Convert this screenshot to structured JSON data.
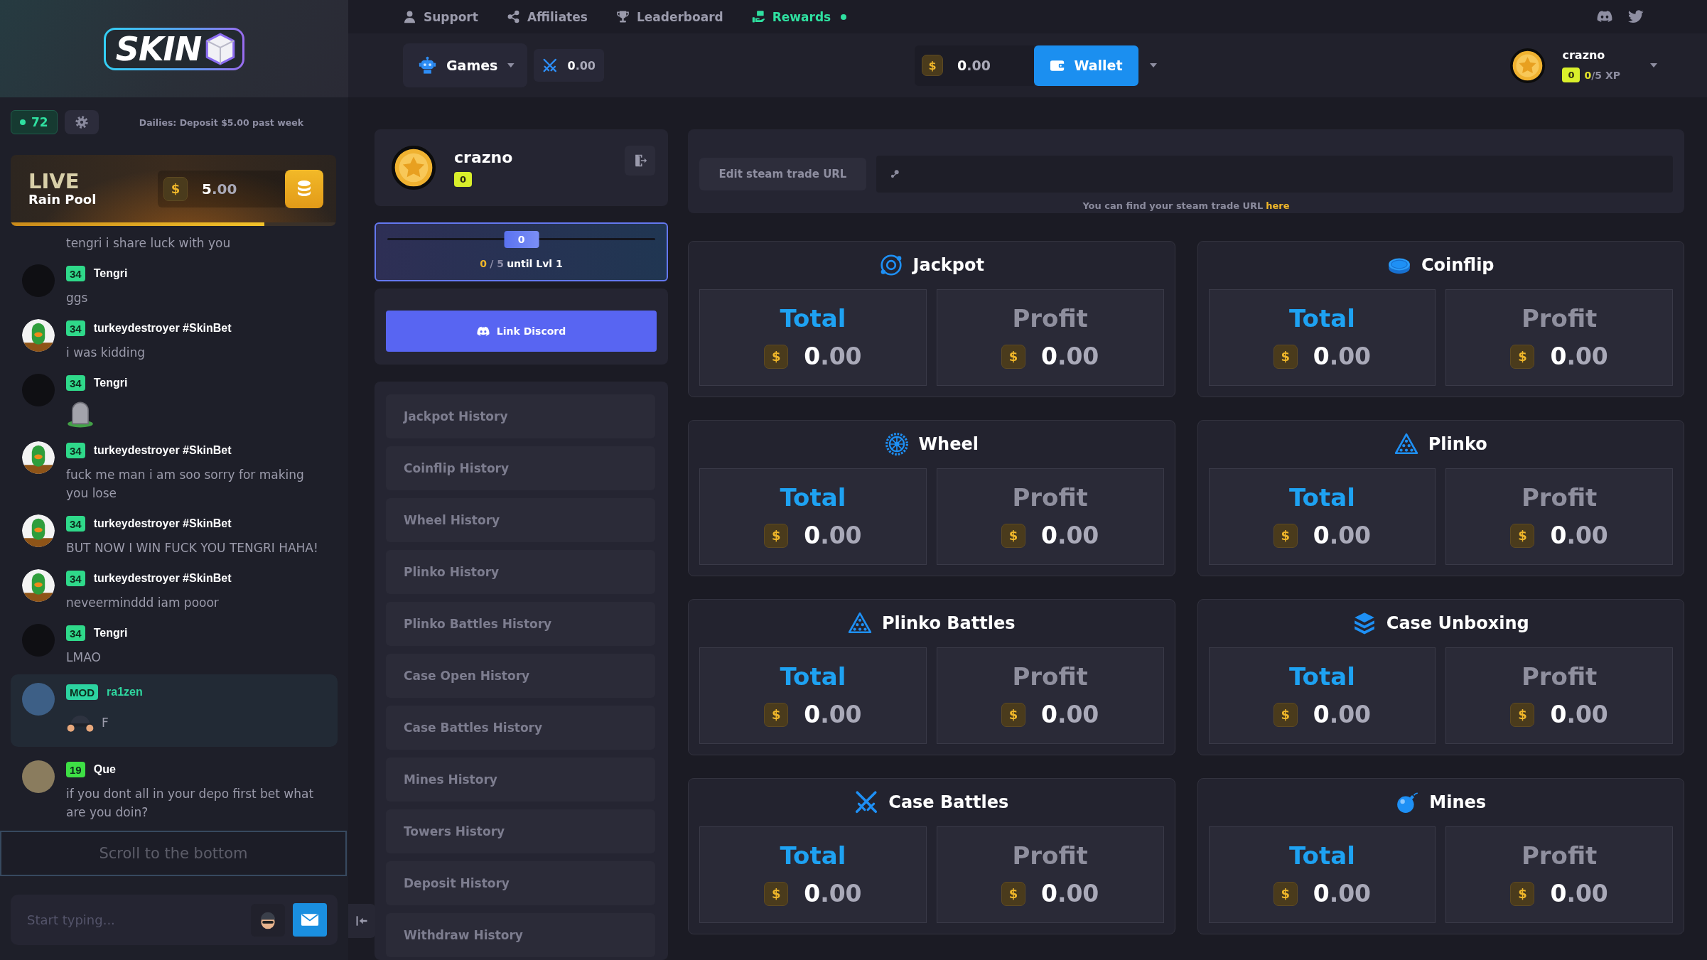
{
  "sidebar": {
    "logo": {
      "text": "SKIN"
    },
    "online_count": "72",
    "dailies": "Dailies: Deposit $5.00 past week",
    "rain_pool": {
      "live": "LIVE",
      "title": "Rain Pool",
      "currency": "$",
      "amount": "5.00",
      "level": 0.78
    },
    "chat": {
      "messages": [
        {
          "highlighted": false,
          "text": "tengri i share luck with you"
        },
        {
          "user": "Tengri",
          "badge": {
            "text": "34",
            "color": "#2fd98a"
          },
          "avatar": {
            "kind": "photo",
            "color": "#0f0f13"
          },
          "highlighted": false,
          "text": "ggs"
        },
        {
          "user": "turkeydestroyer #SkinBet",
          "badge": {
            "text": "34",
            "color": "#2fd98a"
          },
          "avatar": {
            "kind": "duck"
          },
          "highlighted": false,
          "text": "i was kidding"
        },
        {
          "user": "Tengri",
          "badge": {
            "text": "34",
            "color": "#2fd98a"
          },
          "avatar": {
            "kind": "photo",
            "color": "#0f0f13"
          },
          "highlighted": false,
          "emote": {
            "kind": "grave"
          }
        },
        {
          "user": "turkeydestroyer #SkinBet",
          "badge": {
            "text": "34",
            "color": "#2fd98a"
          },
          "avatar": {
            "kind": "duck"
          },
          "highlighted": false,
          "text": "fuck me man i am soo sorry for making you lose"
        },
        {
          "user": "turkeydestroyer #SkinBet",
          "badge": {
            "text": "34",
            "color": "#2fd98a"
          },
          "avatar": {
            "kind": "duck"
          },
          "highlighted": false,
          "text": "BUT NOW I WIN FUCK YOU TENGRI HAHA!"
        },
        {
          "user": "turkeydestroyer #SkinBet",
          "badge": {
            "text": "34",
            "color": "#2fd98a"
          },
          "avatar": {
            "kind": "duck"
          },
          "highlighted": false,
          "text": "neveerminddd iam pooor"
        },
        {
          "user": "Tengri",
          "badge": {
            "text": "34",
            "color": "#2fd98a"
          },
          "avatar": {
            "kind": "photo",
            "color": "#0f0f13"
          },
          "highlighted": false,
          "text": "LMAO"
        },
        {
          "user": "ra1zen",
          "badge": {
            "text": "MOD",
            "color": "#2cd3a0"
          },
          "avatar": {
            "kind": "photo",
            "color": "#3d5f86"
          },
          "highlighted": true,
          "emote": {
            "kind": "cap"
          },
          "text": "F"
        },
        {
          "user": "Que",
          "badge": {
            "text": "19",
            "color": "#3ee045"
          },
          "avatar": {
            "kind": "photo",
            "color": "#8a7c5e"
          },
          "highlighted": false,
          "text": "if you dont all in your depo first bet what are you doin?"
        }
      ],
      "scroll_hint": "Scroll to the bottom",
      "input": {
        "placeholder": "Start typing..."
      }
    }
  },
  "nav": {
    "links": [
      {
        "kind": "support",
        "label": "Support",
        "selected": false,
        "dot": false
      },
      {
        "kind": "affiliates",
        "label": "Affiliates",
        "selected": false,
        "dot": false
      },
      {
        "kind": "leaderboard",
        "label": "Leaderboard",
        "selected": false,
        "dot": false
      },
      {
        "kind": "rewards",
        "label": "Rewards",
        "selected": true,
        "dot": true
      }
    ],
    "games": "Games",
    "battles_balance": "0.00",
    "balance": {
      "currency": "$",
      "value": "0.00"
    },
    "wallet": "Wallet",
    "user": {
      "name": "crazno",
      "rank": "0",
      "xp_current": "0",
      "xp_rest": "/5 XP"
    }
  },
  "profile": {
    "name": "crazno",
    "rank": "0",
    "xp": {
      "marker": "0",
      "current": "0",
      "total": "/ 5",
      "label": "until Lvl 1"
    },
    "discord_button": "Link Discord",
    "history": [
      "Jackpot History",
      "Coinflip History",
      "Wheel History",
      "Plinko History",
      "Plinko Battles History",
      "Case Open History",
      "Case Battles History",
      "Mines History",
      "Towers History",
      "Deposit History",
      "Withdraw History"
    ]
  },
  "trade_url": {
    "button": "Edit steam trade URL",
    "hint": "You can find your steam trade URL",
    "link": "here"
  },
  "games": [
    {
      "kind": "jackpot",
      "title": "Jackpot",
      "stats": [
        {
          "kind": "total",
          "label": "Total",
          "currency": "$",
          "value": "0.00"
        },
        {
          "kind": "profit",
          "label": "Profit",
          "currency": "$",
          "value": "0.00"
        }
      ]
    },
    {
      "kind": "coinflip",
      "title": "Coinflip",
      "stats": [
        {
          "kind": "total",
          "label": "Total",
          "currency": "$",
          "value": "0.00"
        },
        {
          "kind": "profit",
          "label": "Profit",
          "currency": "$",
          "value": "0.00"
        }
      ]
    },
    {
      "kind": "wheel",
      "title": "Wheel",
      "stats": [
        {
          "kind": "total",
          "label": "Total",
          "currency": "$",
          "value": "0.00"
        },
        {
          "kind": "profit",
          "label": "Profit",
          "currency": "$",
          "value": "0.00"
        }
      ]
    },
    {
      "kind": "plinko",
      "title": "Plinko",
      "stats": [
        {
          "kind": "total",
          "label": "Total",
          "currency": "$",
          "value": "0.00"
        },
        {
          "kind": "profit",
          "label": "Profit",
          "currency": "$",
          "value": "0.00"
        }
      ]
    },
    {
      "kind": "plinko",
      "title": "Plinko Battles",
      "stats": [
        {
          "kind": "total",
          "label": "Total",
          "currency": "$",
          "value": "0.00"
        },
        {
          "kind": "profit",
          "label": "Profit",
          "currency": "$",
          "value": "0.00"
        }
      ]
    },
    {
      "kind": "case",
      "title": "Case Unboxing",
      "stats": [
        {
          "kind": "total",
          "label": "Total",
          "currency": "$",
          "value": "0.00"
        },
        {
          "kind": "profit",
          "label": "Profit",
          "currency": "$",
          "value": "0.00"
        }
      ]
    },
    {
      "kind": "battles",
      "title": "Case Battles",
      "stats": [
        {
          "kind": "total",
          "label": "Total",
          "currency": "$",
          "value": "0.00"
        },
        {
          "kind": "profit",
          "label": "Profit",
          "currency": "$",
          "value": "0.00"
        }
      ]
    },
    {
      "kind": "mines",
      "title": "Mines",
      "stats": [
        {
          "kind": "total",
          "label": "Total",
          "currency": "$",
          "value": "0.00"
        },
        {
          "kind": "profit",
          "label": "Profit",
          "currency": "$",
          "value": "0.00"
        }
      ]
    }
  ]
}
